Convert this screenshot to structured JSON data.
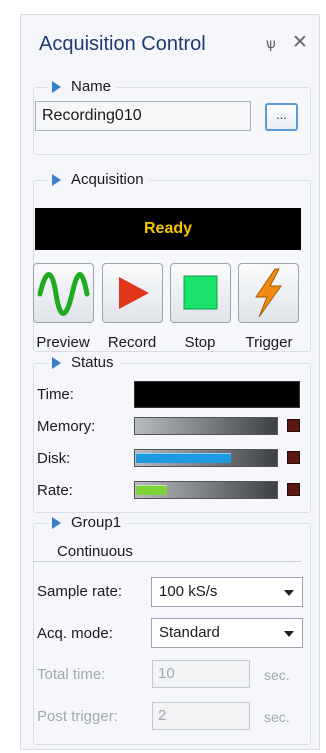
{
  "panel": {
    "title": "Acquisition Control",
    "pin_glyph": "ѱ",
    "close_glyph": "✕"
  },
  "name_group": {
    "header": "Name",
    "value": "Recording010",
    "browse_label": "..."
  },
  "acquisition_group": {
    "header": "Acquisition",
    "status_display": "Ready",
    "controls": [
      {
        "label": "Preview",
        "icon": "sine-wave-icon"
      },
      {
        "label": "Record",
        "icon": "play-triangle-icon"
      },
      {
        "label": "Stop",
        "icon": "stop-square-icon"
      },
      {
        "label": "Trigger",
        "icon": "lightning-icon"
      }
    ]
  },
  "status_group": {
    "header": "Status",
    "rows": [
      {
        "label": "Time:",
        "level": 0,
        "fill_color": "#000000"
      },
      {
        "label": "Memory:",
        "level": 0,
        "fill_color": "#b8bcc2"
      },
      {
        "label": "Disk:",
        "level": 0.68,
        "fill_color": "#1e9be0"
      },
      {
        "label": "Rate:",
        "level": 0.22,
        "fill_color": "#7ed23a"
      }
    ],
    "indicator_color": "#5a1a10"
  },
  "group1": {
    "header": "Group1",
    "subheader": "Continuous",
    "sample_rate": {
      "label": "Sample rate:",
      "value": "100 kS/s"
    },
    "acq_mode": {
      "label": "Acq. mode:",
      "value": "Standard"
    },
    "total_time": {
      "label": "Total time:",
      "value": "10",
      "unit": "sec."
    },
    "post_trigger": {
      "label": "Post trigger:",
      "value": "2",
      "unit": "sec."
    }
  },
  "colors": {
    "title_text": "#1f3b73",
    "accent_blue": "#3c7fc9",
    "ready_text": "#f6c700"
  }
}
